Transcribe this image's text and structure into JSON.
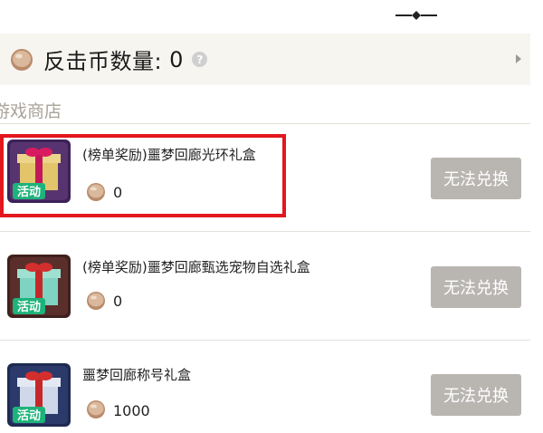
{
  "coin_bar": {
    "label": "反击币数量:",
    "value": "0",
    "help_icon": "question-icon",
    "arrow_icon": "caret-right-icon"
  },
  "shop": {
    "title": "游戏商店",
    "items": [
      {
        "name": "(榜单奖励)噩梦回廊光环礼盒",
        "price": "0",
        "button": "无法兑换",
        "thumb_badge": "活动",
        "thumb_colors": {
          "bg": "#4a2b6b",
          "box": "#e6c86a",
          "ribbon": "#c2185b",
          "badge": "#1db37a"
        }
      },
      {
        "name": "(榜单奖励)噩梦回廊甄选宠物自选礼盒",
        "price": "0",
        "button": "无法兑换",
        "thumb_badge": "活动",
        "thumb_colors": {
          "bg": "#5a2e2a",
          "box": "#7fd3c1",
          "ribbon": "#c62828",
          "badge": "#1db37a"
        }
      },
      {
        "name": "噩梦回廊称号礼盒",
        "price": "1000",
        "button": "无法兑换",
        "thumb_badge": "活动",
        "thumb_colors": {
          "bg": "#2b3a6b",
          "box": "#cfd8e8",
          "ribbon": "#c62828",
          "badge": "#1db37a"
        }
      }
    ]
  },
  "highlight_color": "#e3171e"
}
